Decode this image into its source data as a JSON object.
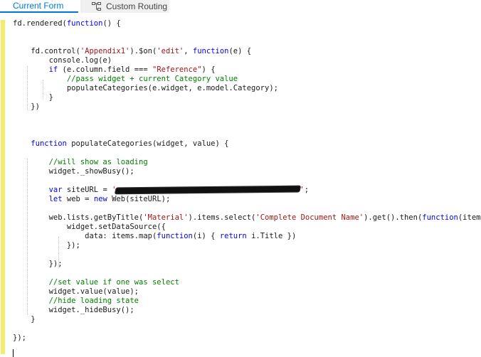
{
  "tabs": {
    "current_form": "Current Form",
    "custom_routing": "Custom Routing"
  },
  "code_lines": [
    [
      [
        "t",
        "fd.rendered("
      ],
      [
        "k",
        "function"
      ],
      [
        "t",
        "() {"
      ]
    ],
    [],
    [],
    [
      [
        "t",
        "    fd.control("
      ],
      [
        "s",
        "'Appendix1'"
      ],
      [
        "t",
        ").$on("
      ],
      [
        "s",
        "'edit'"
      ],
      [
        "t",
        ", "
      ],
      [
        "k",
        "function"
      ],
      [
        "t",
        "(e) {"
      ]
    ],
    [
      [
        "t",
        "        console.log(e)"
      ]
    ],
    [
      [
        "t",
        "        "
      ],
      [
        "k",
        "if"
      ],
      [
        "t",
        " (e.column.field === "
      ],
      [
        "s",
        "\"Reference\""
      ],
      [
        "t",
        ") {"
      ]
    ],
    [
      [
        "t",
        "            "
      ],
      [
        "c",
        "//pass widget + current Category value"
      ]
    ],
    [
      [
        "t",
        "            populateCategories(e.widget, e.model.Category);"
      ]
    ],
    [
      [
        "t",
        "        }"
      ]
    ],
    [
      [
        "t",
        "    })"
      ]
    ],
    [],
    [],
    [],
    [
      [
        "t",
        "    "
      ],
      [
        "k",
        "function"
      ],
      [
        "t",
        " populateCategories(widget, value) {"
      ]
    ],
    [],
    [
      [
        "t",
        "        "
      ],
      [
        "c",
        "//will show as loading"
      ]
    ],
    [
      [
        "t",
        "        widget._showBusy();"
      ]
    ],
    [],
    [
      [
        "t",
        "        "
      ],
      [
        "k",
        "var"
      ],
      [
        "t",
        " siteURL = "
      ],
      [
        "s",
        "'"
      ],
      [
        "r",
        ""
      ],
      [
        "s",
        "'"
      ],
      [
        "t",
        ";"
      ]
    ],
    [
      [
        "t",
        "        "
      ],
      [
        "k",
        "let"
      ],
      [
        "t",
        " web = "
      ],
      [
        "k",
        "new"
      ],
      [
        "t",
        " Web(siteURL);"
      ]
    ],
    [],
    [
      [
        "t",
        "        web.lists.getByTitle("
      ],
      [
        "s",
        "'Material'"
      ],
      [
        "t",
        ").items.select("
      ],
      [
        "s",
        "'Complete Document Name'"
      ],
      [
        "t",
        ").get().then("
      ],
      [
        "k",
        "function"
      ],
      [
        "t",
        "(items) {"
      ]
    ],
    [
      [
        "t",
        "            widget.setDataSource({"
      ]
    ],
    [
      [
        "t",
        "                data: items.map("
      ],
      [
        "k",
        "function"
      ],
      [
        "t",
        "(i) { "
      ],
      [
        "k",
        "return"
      ],
      [
        "t",
        " i.Title })"
      ]
    ],
    [
      [
        "t",
        "            });"
      ]
    ],
    [],
    [
      [
        "t",
        "        });"
      ]
    ],
    [],
    [
      [
        "t",
        "        "
      ],
      [
        "c",
        "//set value if one was select"
      ]
    ],
    [
      [
        "t",
        "        widget.value(value);"
      ]
    ],
    [
      [
        "t",
        "        "
      ],
      [
        "c",
        "//hide loading state"
      ]
    ],
    [
      [
        "t",
        "        widget._hideBusy();"
      ]
    ],
    [
      [
        "t",
        "    }"
      ]
    ],
    [],
    [
      [
        "t",
        "});"
      ]
    ]
  ]
}
